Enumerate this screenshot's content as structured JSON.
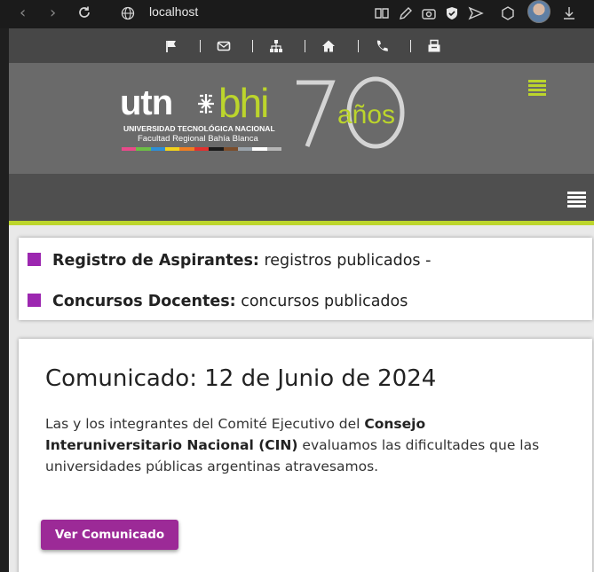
{
  "browser": {
    "url": "localhost"
  },
  "site": {
    "logo_left": "utn",
    "logo_right": "bhi",
    "logo_university": "UNIVERSIDAD TECNOLÓGICA NACIONAL",
    "logo_faculty": "Facultad Regional Bahía Blanca",
    "anniversary_number": "70",
    "anniversary_label": "años",
    "accent_color": "#bcd52c",
    "brand_purple": "#9c27b0"
  },
  "listing": {
    "items": [
      {
        "title": "Registro de Aspirantes:",
        "text": " registros publicados -"
      },
      {
        "title": "Concursos Docentes:",
        "text": " concursos publicados"
      }
    ]
  },
  "announcement": {
    "heading": "Comunicado: 12 de Junio de 2024",
    "body_start": "Las y los integrantes del Comité Ejecutivo del ",
    "body_bold": "Consejo Interuniversitario Nacional (CIN)",
    "body_end": " evaluamos las dificultades que las universidades públicas argentinas atravesamos.",
    "button_label": "Ver Comunicado"
  }
}
